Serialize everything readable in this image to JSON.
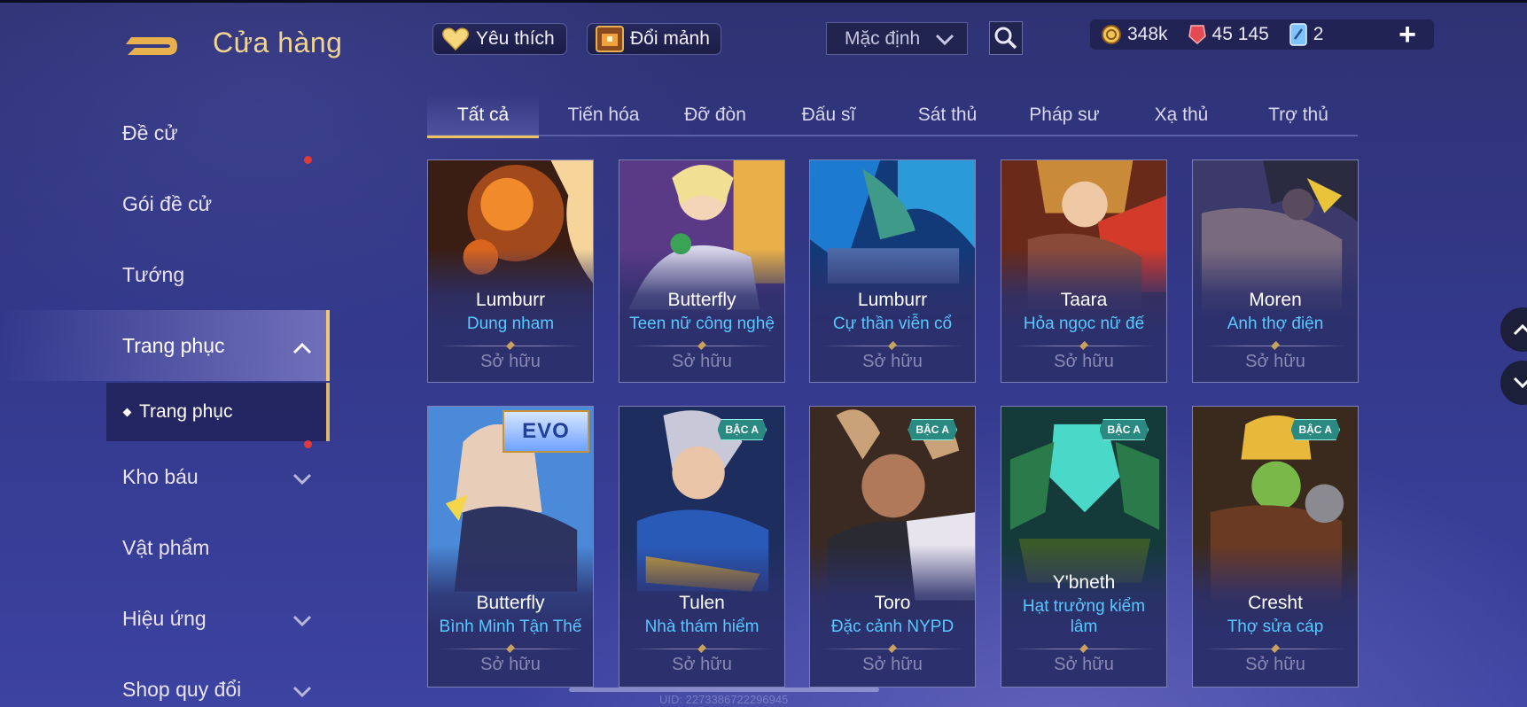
{
  "header": {
    "title": "Cửa hàng",
    "favorites_label": "Yêu thích",
    "exchange_label": "Đổi mảnh",
    "sort": {
      "selected": "Mặc định"
    },
    "currencies": [
      {
        "icon": "gold-coin-icon",
        "value": "348k"
      },
      {
        "icon": "ruby-gem-icon",
        "value": "45 145"
      },
      {
        "icon": "voucher-card-icon",
        "value": "2"
      }
    ],
    "add_label": "+"
  },
  "sidebar": {
    "items": [
      {
        "label": "Đề cử"
      },
      {
        "label": "Gói đề cử",
        "notification": true
      },
      {
        "label": "Tướng"
      },
      {
        "label": "Trang phục",
        "expanded": true
      },
      {
        "label": "Kho báu",
        "notification": true
      },
      {
        "label": "Vật phẩm"
      },
      {
        "label": "Hiệu ứng"
      },
      {
        "label": "Shop quy đổi"
      }
    ],
    "sub_item": "Trang phục"
  },
  "tabs": [
    "Tất cả",
    "Tiến hóa",
    "Đỡ đòn",
    "Đấu sĩ",
    "Sát thủ",
    "Pháp sư",
    "Xạ thủ",
    "Trợ thủ"
  ],
  "active_tab": "Tất cả",
  "cards": [
    {
      "hero": "Lumburr",
      "skin": "Dung nham",
      "status": "Sở hữu",
      "badge": ""
    },
    {
      "hero": "Butterfly",
      "skin": "Teen nữ công nghệ",
      "status": "Sở hữu",
      "badge": ""
    },
    {
      "hero": "Lumburr",
      "skin": "Cự thần viễn cổ",
      "status": "Sở hữu",
      "badge": ""
    },
    {
      "hero": "Taara",
      "skin": "Hỏa ngọc nữ đế",
      "status": "Sở hữu",
      "badge": ""
    },
    {
      "hero": "Moren",
      "skin": "Anh thợ điện",
      "status": "Sở hữu",
      "badge": ""
    },
    {
      "hero": "Butterfly",
      "skin": "Bình Minh Tận Thế",
      "status": "Sở hữu",
      "badge": "EVO"
    },
    {
      "hero": "Tulen",
      "skin": "Nhà thám hiểm",
      "status": "Sở hữu",
      "badge": "BẬC A"
    },
    {
      "hero": "Toro",
      "skin": "Đặc cảnh NYPD",
      "status": "Sở hữu",
      "badge": "BẬC A"
    },
    {
      "hero": "Y'bneth",
      "skin": "Hạt trưởng kiểm lâm",
      "status": "Sở hữu",
      "badge": "BẬC A"
    },
    {
      "hero": "Cresht",
      "skin": "Thợ sửa cáp",
      "status": "Sở hữu",
      "badge": "BẬC A"
    }
  ],
  "footer": {
    "uid": "UID: 2273386722296945"
  },
  "colors": {
    "accent_gold": "#f1c463",
    "skin_name": "#59c8ff",
    "notification": "#e03a3a"
  }
}
